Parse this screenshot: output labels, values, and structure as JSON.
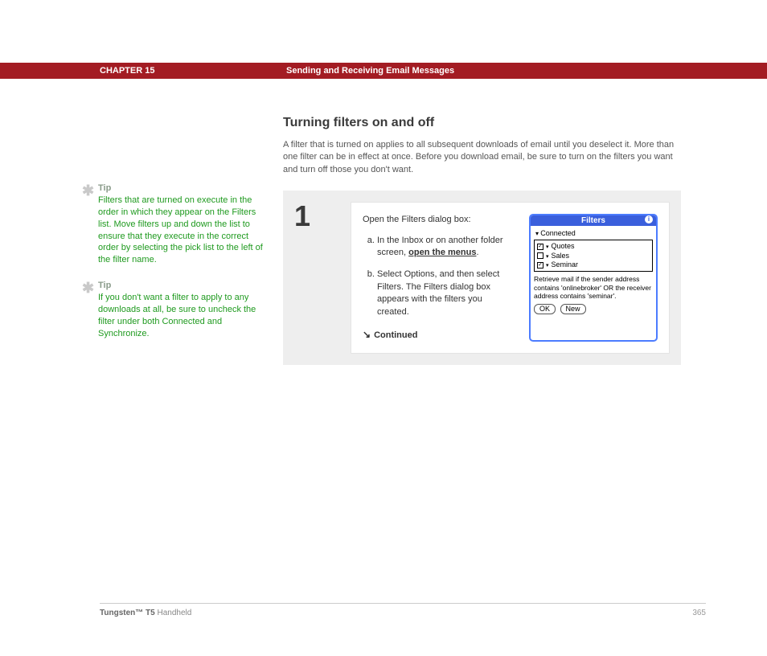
{
  "header": {
    "chapter": "CHAPTER 15",
    "title": "Sending and Receiving Email Messages"
  },
  "sidebar": {
    "tips": [
      {
        "label": "Tip",
        "text": "Filters that are turned on execute in the order in which they appear on the Filters list. Move filters up and down the list to ensure that they execute in the correct order by selecting the pick list to the left of the filter name."
      },
      {
        "label": "Tip",
        "text": "If you don't want a filter to apply to any downloads at all, be sure to uncheck the filter under both Connected and Synchronize."
      }
    ]
  },
  "main": {
    "heading": "Turning filters on and off",
    "intro": "A filter that is turned on applies to all subsequent downloads of email until you deselect it. More than one filter can be in effect at once. Before you download email, be sure to turn on the filters you want and turn off those you don't want.",
    "step_number": "1",
    "step_head": "Open the Filters dialog box:",
    "step_a_prefix": "In the Inbox or on another folder screen, ",
    "step_a_link": "open the menus",
    "step_a_suffix": ".",
    "step_b": "Select Options, and then select Filters. The Filters dialog box appears with the filters you created.",
    "continued": "Continued"
  },
  "dialog": {
    "title": "Filters",
    "info": "i",
    "dropdown": "Connected",
    "rows": [
      {
        "checked": true,
        "name": "Quotes"
      },
      {
        "checked": false,
        "name": "Sales"
      },
      {
        "checked": true,
        "name": "Seminar"
      }
    ],
    "description": "Retrieve mail if the sender address contains 'onlinebroker' OR the receiver address contains 'seminar'.",
    "buttons": {
      "ok": "OK",
      "new": "New"
    }
  },
  "footer": {
    "product_strong": "Tungsten™ T5",
    "product_rest": " Handheld",
    "page": "365"
  }
}
